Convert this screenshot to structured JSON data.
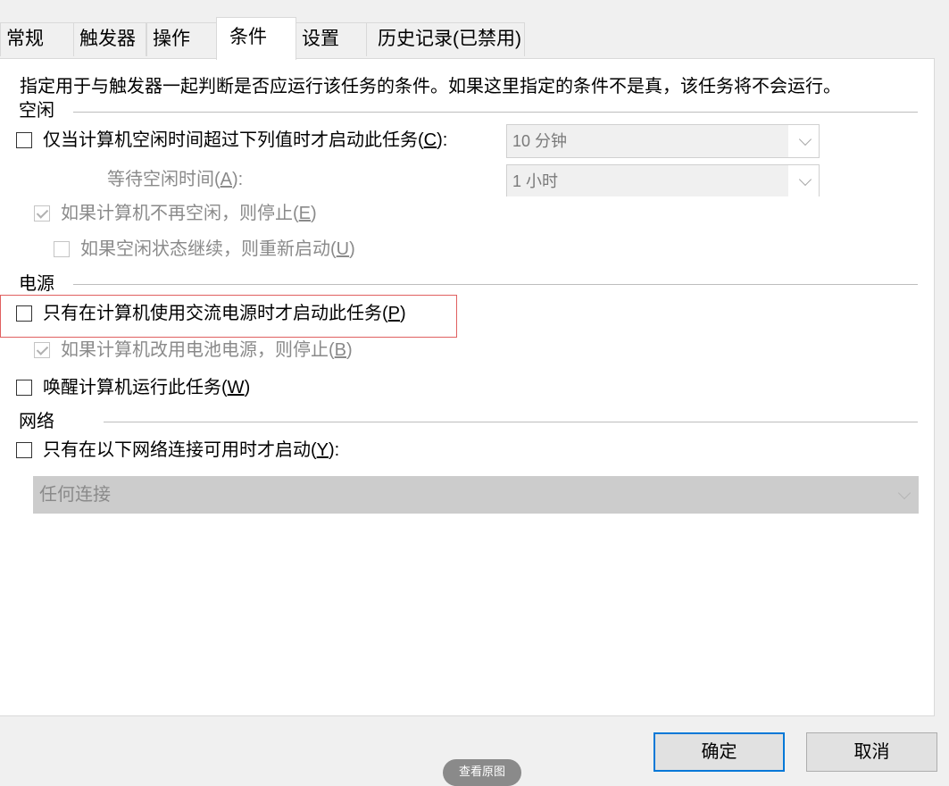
{
  "tabs": [
    "常规",
    "触发器",
    "操作",
    "条件",
    "设置",
    "历史记录(已禁用)"
  ],
  "active_tab": "条件",
  "description": "指定用于与触发器一起判断是否应运行该任务的条件。如果这里指定的条件不是真，该任务将不会运行。",
  "idle": {
    "group_label": "空闲",
    "start_only_if_idle": {
      "text": "仅当计算机空闲时间超过下列值时才启动此任务(",
      "key": "C",
      "suffix": "):",
      "checked": false
    },
    "idle_duration": "10 分钟",
    "wait_label": {
      "text": "等待空闲时间(",
      "key": "A",
      "suffix": "):"
    },
    "wait_duration": "1 小时",
    "stop_if_not_idle": {
      "text": "如果计算机不再空闲，则停止(",
      "key": "E",
      "suffix": ")",
      "checked": true,
      "disabled": true
    },
    "restart_if_idle": {
      "text": "如果空闲状态继续，则重新启动(",
      "key": "U",
      "suffix": ")",
      "checked": false,
      "disabled": true
    }
  },
  "power": {
    "group_label": "电源",
    "ac_only": {
      "text": "只有在计算机使用交流电源时才启动此任务(",
      "key": "P",
      "suffix": ")",
      "checked": false
    },
    "stop_on_battery": {
      "text": "如果计算机改用电池电源，则停止(",
      "key": "B",
      "suffix": ")",
      "checked": true,
      "disabled": true
    },
    "wake": {
      "text": "唤醒计算机运行此任务(",
      "key": "W",
      "suffix": ")",
      "checked": false
    }
  },
  "network": {
    "group_label": "网络",
    "network_only": {
      "text": "只有在以下网络连接可用时才启动(",
      "key": "Y",
      "suffix": "):",
      "checked": false
    },
    "connection": "任何连接"
  },
  "buttons": {
    "ok": "确定",
    "cancel": "取消"
  },
  "overlay_pill": "查看原图",
  "colors": {
    "highlight_border": "#e06060",
    "primary_button_border": "#0078d7"
  }
}
